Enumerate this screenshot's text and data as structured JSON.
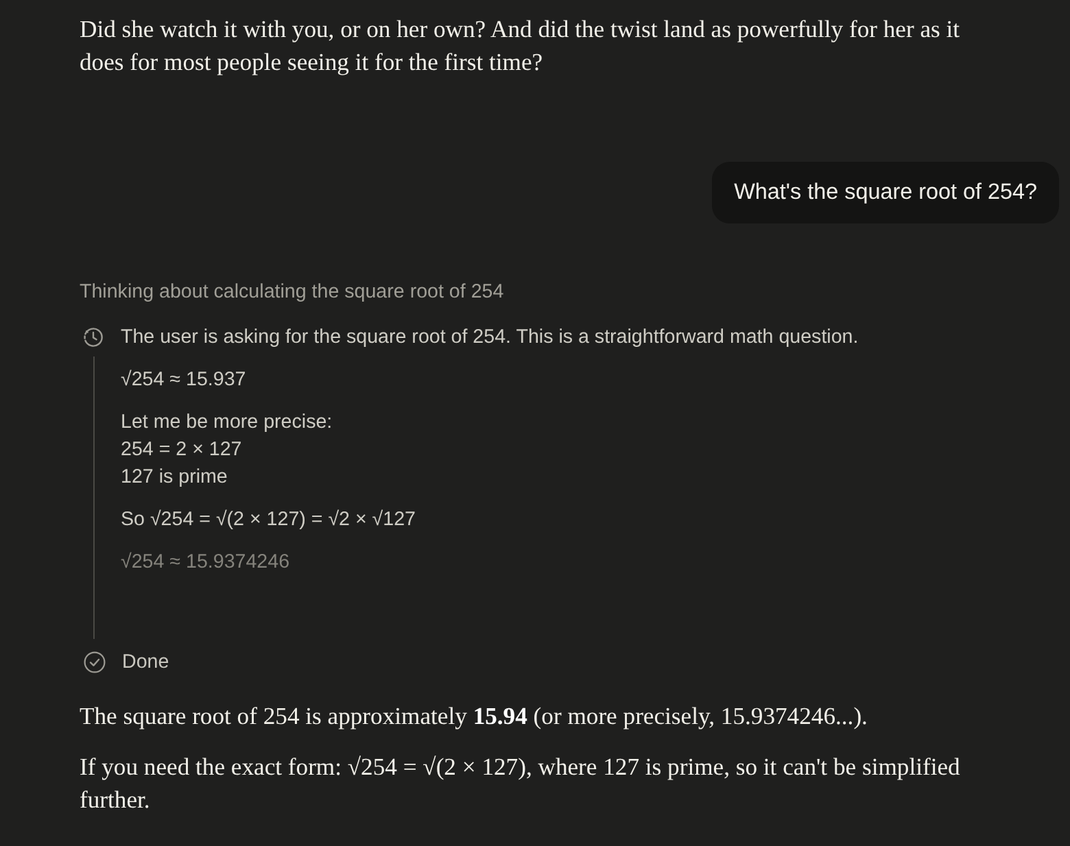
{
  "conversation": [
    {
      "kind": "assistant",
      "paragraphs": [
        "Did she watch it with you, or on her own? And did the twist land as powerfully for her as it does for most people seeing it for the first time?"
      ]
    },
    {
      "kind": "user",
      "text": "What's the square root of 254?"
    },
    {
      "kind": "thinking",
      "title": "Thinking about calculating the square root of 254",
      "steps": [
        {
          "text": "The user is asking for the square root of 254. This is a straightforward math question.",
          "faded": false
        },
        {
          "text": "√254 ≈ 15.937",
          "faded": false
        },
        {
          "text": "Let me be more precise:\n254 = 2 × 127\n127 is prime",
          "faded": false
        },
        {
          "text": "So √254 = √(2 × 127) = √2 × √127",
          "faded": false
        },
        {
          "text": "√254 ≈ 15.9374246",
          "faded": true
        }
      ],
      "status": "Done"
    },
    {
      "kind": "assistant",
      "paragraphs": [
        "The square root of 254 is approximately **15.94** (or more precisely, 15.9374246...).",
        "If you need the exact form: √254 = √(2 × 127), where 127 is prime, so it can't be simplified further."
      ]
    }
  ]
}
